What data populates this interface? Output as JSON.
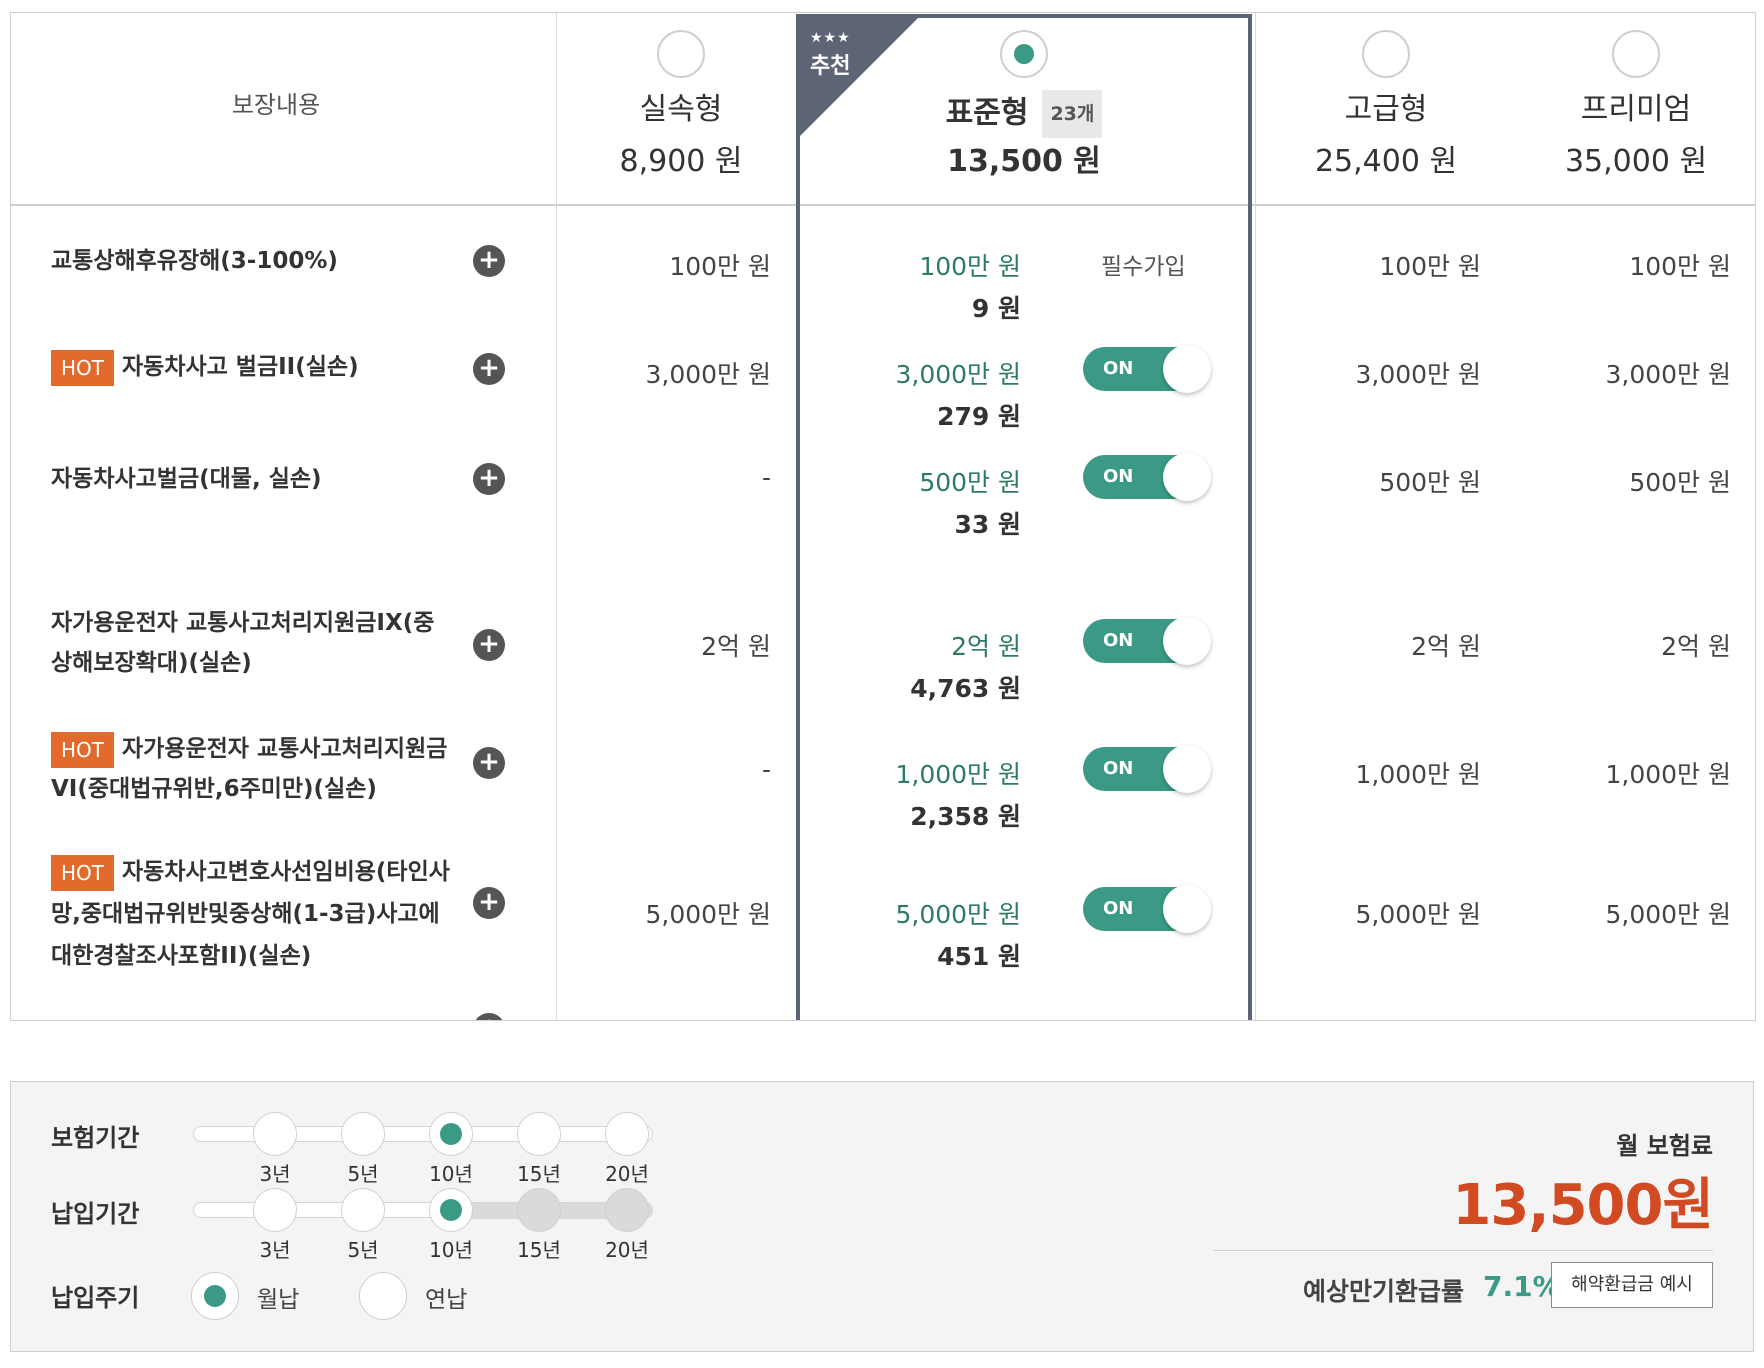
{
  "table": {
    "coverage_header": "보장내용",
    "recommend": {
      "stars": "★★★",
      "label": "추천"
    },
    "plans": [
      {
        "name": "실속형",
        "price": "8,900 원",
        "selected": false
      },
      {
        "name": "표준형",
        "badge": "23개",
        "price": "13,500 원",
        "selected": true
      },
      {
        "name": "고급형",
        "price": "25,400 원",
        "selected": false
      },
      {
        "name": "프리미엄",
        "price": "35,000 원",
        "selected": false
      }
    ],
    "rows": [
      {
        "hot": "",
        "name": "교통상해후유장해(3-100%)",
        "basic": "100만 원",
        "std_amount": "100만 원",
        "std_premium": "9 원",
        "std_status": "필수가입",
        "toggle": "",
        "advanced": "100만 원",
        "premium": "100만 원"
      },
      {
        "hot": "HOT",
        "name": "자동차사고 벌금II(실손)",
        "basic": "3,000만 원",
        "std_amount": "3,000만 원",
        "std_premium": "279 원",
        "std_status": "",
        "toggle": "ON",
        "advanced": "3,000만 원",
        "premium": "3,000만 원"
      },
      {
        "hot": "",
        "name": "자동차사고벌금(대물, 실손)",
        "basic": "-",
        "std_amount": "500만 원",
        "std_premium": "33 원",
        "std_status": "",
        "toggle": "ON",
        "advanced": "500만 원",
        "premium": "500만 원"
      },
      {
        "hot": "",
        "name": "자가용운전자 교통사고처리지원금IX(중상해보장확대)(실손)",
        "basic": "2억 원",
        "std_amount": "2억 원",
        "std_premium": "4,763 원",
        "std_status": "",
        "toggle": "ON",
        "advanced": "2억 원",
        "premium": "2억 원"
      },
      {
        "hot": "HOT",
        "name": "자가용운전자 교통사고처리지원금VI(중대법규위반,6주미만)(실손)",
        "basic": "-",
        "std_amount": "1,000만 원",
        "std_premium": "2,358 원",
        "std_status": "",
        "toggle": "ON",
        "advanced": "1,000만 원",
        "premium": "1,000만 원"
      },
      {
        "hot": "HOT",
        "name": "자동차사고변호사선임비용(타인사망,중대법규위반및중상해(1-3급)사고에대한경찰조사포함II)(실손)",
        "basic": "5,000만 원",
        "std_amount": "5,000만 원",
        "std_premium": "451 원",
        "std_status": "",
        "toggle": "ON",
        "advanced": "5,000만 원",
        "premium": "5,000만 원"
      }
    ]
  },
  "options": {
    "insurance_period": {
      "label": "보험기간",
      "ticks": [
        "3년",
        "5년",
        "10년",
        "15년",
        "20년"
      ],
      "selected": "10년"
    },
    "payment_period": {
      "label": "납입기간",
      "ticks": [
        "3년",
        "5년",
        "10년",
        "15년",
        "20년"
      ],
      "selected": "10년"
    },
    "payment_cycle": {
      "label": "납입주기",
      "options": [
        "월납",
        "연납"
      ],
      "selected": "월납"
    }
  },
  "summary": {
    "monthly_label": "월 보험료",
    "monthly_value": "13,500원",
    "refund_label": "예상만기환급률",
    "refund_rate": "7.1%",
    "refund_button": "해약환급금 예시"
  },
  "colors": {
    "accent_green": "#3a9a85",
    "hot_orange": "#e26a2c",
    "price_red": "#d24a22",
    "recommend_gray": "#5d6475"
  }
}
